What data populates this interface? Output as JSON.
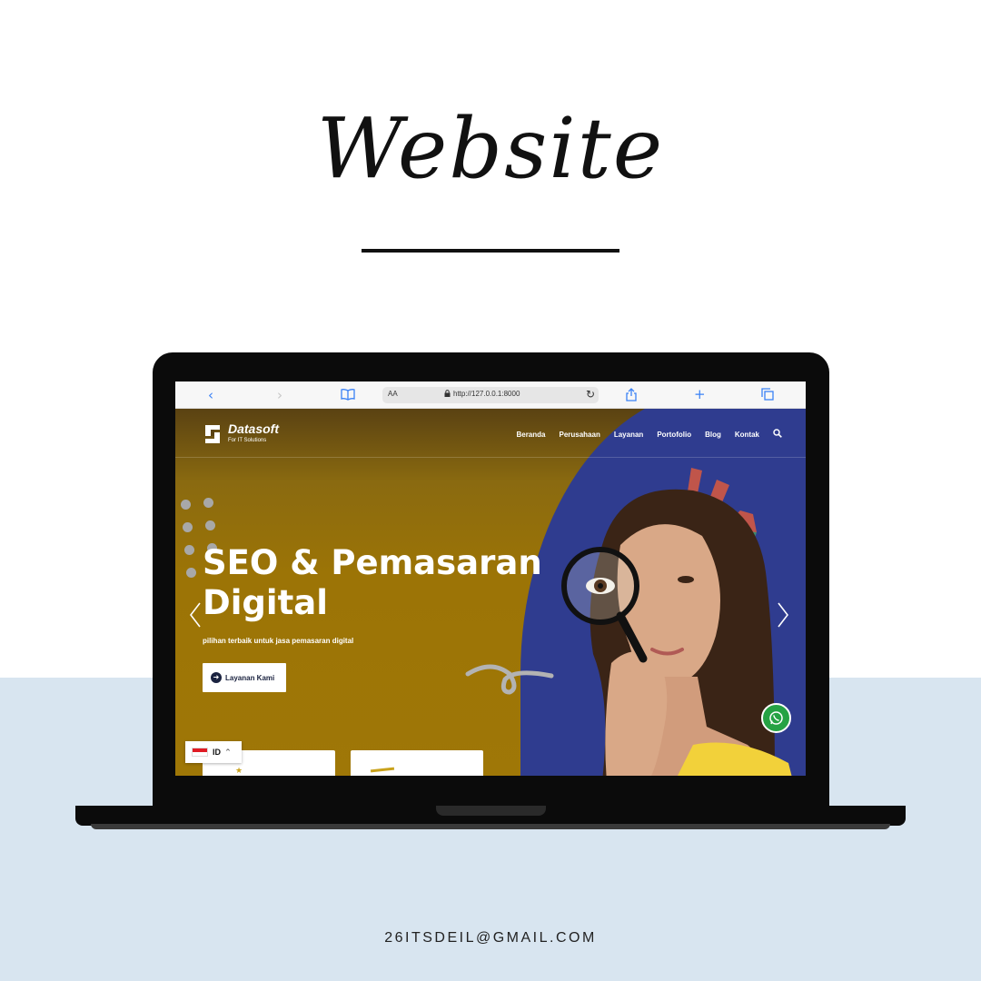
{
  "heading": {
    "title": "Website"
  },
  "footer": {
    "email": "26ITSDEIL@GMAIL.COM"
  },
  "browser": {
    "back_icon": "‹",
    "forward_icon": "›",
    "reader_label": "AA",
    "url": "http://127.0.0.1:8000",
    "accent": "#3b82f6"
  },
  "site": {
    "brand_name": "Datasoft",
    "brand_tagline": "For IT Solutions",
    "nav": [
      {
        "label": "Beranda"
      },
      {
        "label": "Perusahaan"
      },
      {
        "label": "Layanan"
      },
      {
        "label": "Portofolio"
      },
      {
        "label": "Blog"
      },
      {
        "label": "Kontak"
      }
    ],
    "hero": {
      "title_line1": "SEO & Pemasaran",
      "title_line2": "Digital",
      "subtitle": "pilihan terbaik untuk jasa pemasaran digital",
      "cta_label": "Layanan Kami"
    },
    "language": {
      "code": "ID"
    },
    "colors": {
      "hero_gold": "#9f7707",
      "hero_blue": "#2f3c8f",
      "whatsapp": "#25a244"
    }
  }
}
